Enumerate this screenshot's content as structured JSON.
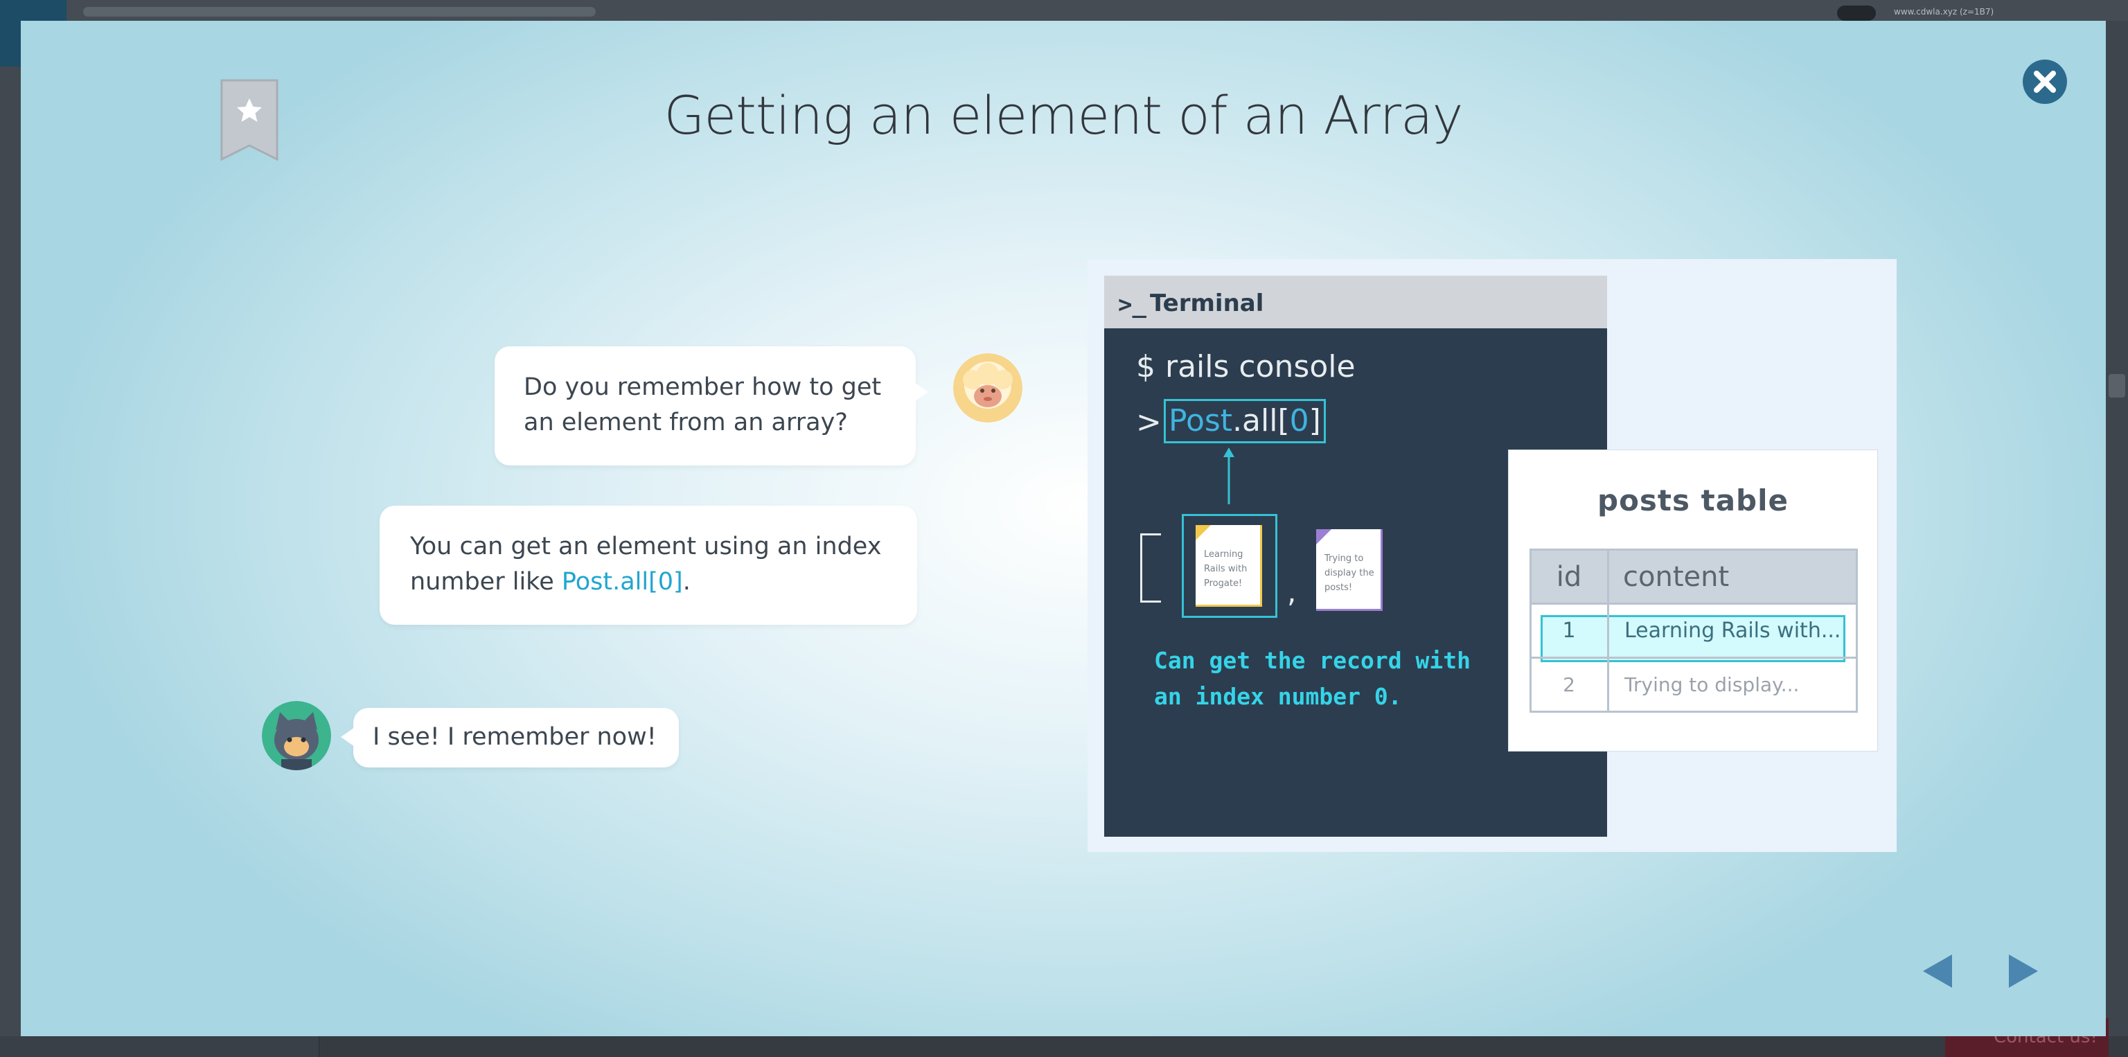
{
  "background": {
    "user_label": "www.cdwla.xyz (z=1B7)",
    "contact_label": "Contact us!"
  },
  "modal": {
    "title": "Getting an element of an Array",
    "close_icon": "close-icon",
    "bookmark_icon": "star-bookmark-icon",
    "nav": {
      "prev_icon": "triangle-left-icon",
      "next_icon": "triangle-right-icon"
    }
  },
  "dialogue": {
    "bubble1": "Do you remember how to get an element from an array?",
    "bubble2_before": "You can get an element using an index number like ",
    "bubble2_code": "Post.all[0]",
    "bubble2_after": ".",
    "bubble3": "I see! I remember now!"
  },
  "slide": {
    "terminal_title": "Terminal",
    "terminal_icon": ">_",
    "line1": "$ rails console",
    "prompt": ">",
    "code_model": "Post",
    "code_method": ".all[",
    "code_index": "0",
    "code_close": "]",
    "doc1": "Learning Rails with Progate!",
    "doc2": "Trying to display the posts!",
    "comma": ",",
    "caption": "Can get the record with an index number 0.",
    "table": {
      "title": "posts table",
      "headers": [
        "id",
        "content"
      ],
      "rows": [
        {
          "id": "1",
          "content": "Learning Rails with..."
        },
        {
          "id": "2",
          "content": "Trying to display..."
        }
      ]
    }
  },
  "colors": {
    "accent": "#35c2d4",
    "code_blue": "#3fb4e0",
    "close_button": "#2b6a8d",
    "nav_arrows": "#4a86b0"
  }
}
